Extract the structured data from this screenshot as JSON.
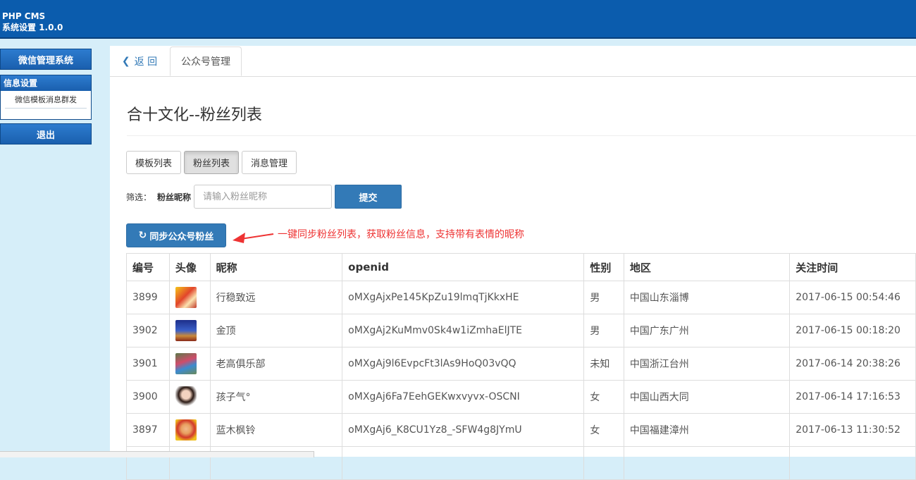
{
  "header": {
    "app_name": "PHP CMS",
    "subtitle": "系统设置 1.0.0"
  },
  "sidebar": {
    "section_top": "微信管理系统",
    "group_title": "信息设置",
    "group_item": "微信模板消息群发",
    "logout": "退出"
  },
  "tabs": {
    "back": "返 回",
    "active": "公众号管理"
  },
  "page": {
    "title": "合十文化--粉丝列表"
  },
  "buttons": {
    "template_list": "模板列表",
    "fan_list": "粉丝列表",
    "message_mgmt": "消息管理"
  },
  "filter": {
    "label": "筛选：",
    "field_label": "粉丝昵称",
    "placeholder": "请输入粉丝昵称",
    "submit": "提交"
  },
  "sync": {
    "label": "同步公众号粉丝"
  },
  "annotation": {
    "text": "一键同步粉丝列表，获取粉丝信息，支持带有表情的昵称",
    "color": "#e33333"
  },
  "table": {
    "headers": [
      "编号",
      "头像",
      "昵称",
      "openid",
      "性别",
      "地区",
      "关注时间"
    ],
    "rows": [
      {
        "id": "3899",
        "nickname": "行稳致远",
        "openid": "oMXgAjxPe145KpZu19lmqTjKkxHE",
        "gender": "男",
        "region": "中国山东淄博",
        "time": "2017-06-15 00:54:46"
      },
      {
        "id": "3902",
        "nickname": "金顶",
        "openid": "oMXgAj2KuMmv0Sk4w1iZmhaElJTE",
        "gender": "男",
        "region": "中国广东广州",
        "time": "2017-06-15 00:18:20"
      },
      {
        "id": "3901",
        "nickname": "老高俱乐部",
        "openid": "oMXgAj9l6EvpcFt3lAs9HoQ03vQQ",
        "gender": "未知",
        "region": "中国浙江台州",
        "time": "2017-06-14 20:38:26"
      },
      {
        "id": "3900",
        "nickname": "孩子气°",
        "openid": "oMXgAj6Fa7EehGEKwxvyvx-OSCNI",
        "gender": "女",
        "region": "中国山西大同",
        "time": "2017-06-14 17:16:53"
      },
      {
        "id": "3897",
        "nickname": "蓝木枫铃",
        "openid": "oMXgAj6_K8CU1Yz8_-SFW4g8JYmU",
        "gender": "女",
        "region": "中国福建漳州",
        "time": "2017-06-13 11:30:52"
      }
    ]
  },
  "colors": {
    "header_bg": "#0b5cad",
    "primary": "#337ab7",
    "sidebar_bg": "#d6eef9"
  }
}
